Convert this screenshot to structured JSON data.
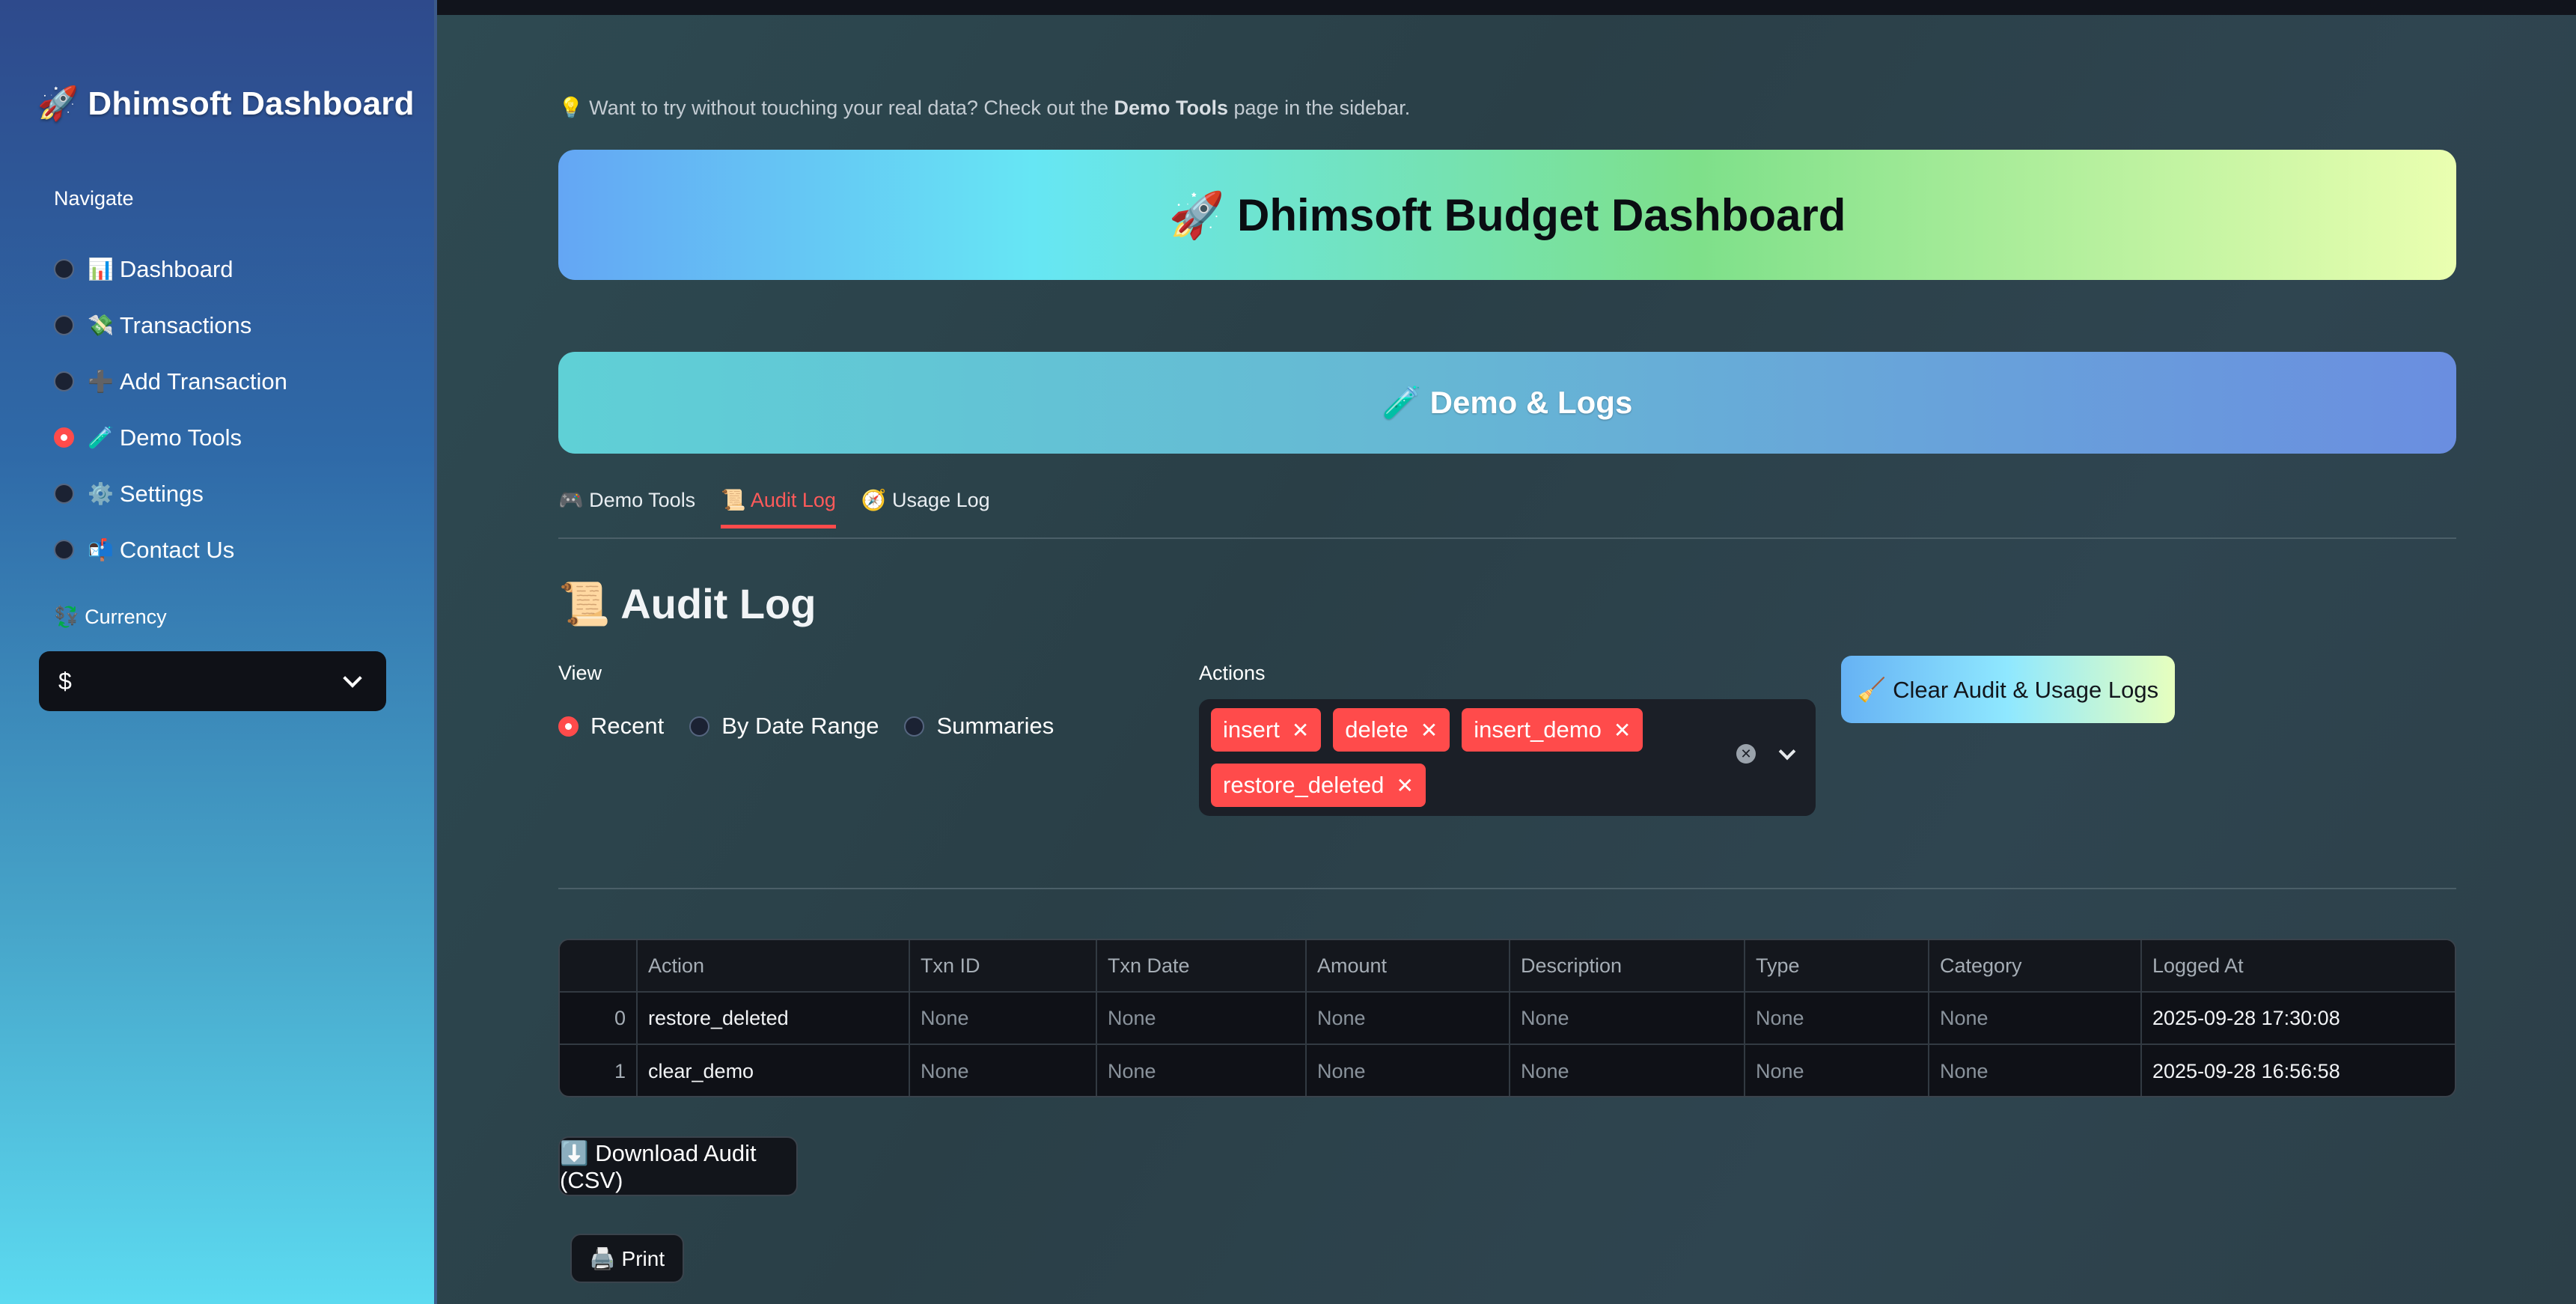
{
  "sidebar": {
    "brand": "🚀 Dhimsoft Dashboard",
    "navigate_label": "Navigate",
    "items": [
      {
        "icon": "📊",
        "label": "Dashboard"
      },
      {
        "icon": "💸",
        "label": "Transactions"
      },
      {
        "icon": "➕",
        "label": "Add Transaction"
      },
      {
        "icon": "🧪",
        "label": "Demo Tools"
      },
      {
        "icon": "⚙️",
        "label": "Settings"
      },
      {
        "icon": "📬",
        "label": "Contact Us"
      }
    ],
    "selected_index": 3,
    "currency_label": "💱 Currency",
    "currency_value": "$"
  },
  "hint": {
    "prefix": "💡 Want to try without touching your real data? Check out the ",
    "bold": "Demo Tools",
    "suffix": " page in the sidebar."
  },
  "hero_title": "🚀 Dhimsoft Budget Dashboard",
  "section_banner": "🧪 Demo & Logs",
  "tabs": [
    {
      "label": "🎮 Demo Tools"
    },
    {
      "label": "📜 Audit Log"
    },
    {
      "label": "🧭 Usage Log"
    }
  ],
  "active_tab": 1,
  "page_title": "📜 Audit Log",
  "view": {
    "label": "View",
    "options": [
      "Recent",
      "By Date Range",
      "Summaries"
    ],
    "selected_index": 0
  },
  "actions": {
    "label": "Actions",
    "chips": [
      "insert",
      "delete",
      "insert_demo",
      "restore_deleted"
    ]
  },
  "clear_button": "🧹 Clear Audit & Usage Logs",
  "table": {
    "columns": [
      "",
      "Action",
      "Txn ID",
      "Txn Date",
      "Amount",
      "Description",
      "Type",
      "Category",
      "Logged At"
    ],
    "rows": [
      [
        "0",
        "restore_deleted",
        "None",
        "None",
        "None",
        "None",
        "None",
        "None",
        "2025-09-28 17:30:08"
      ],
      [
        "1",
        "clear_demo",
        "None",
        "None",
        "None",
        "None",
        "None",
        "None",
        "2025-09-28 16:56:58"
      ]
    ]
  },
  "download_button": "⬇️ Download Audit (CSV)",
  "print_button": "🖨️ Print",
  "colors": {
    "accent": "#ff4b4b",
    "sidebar_top": "#2e4a8c",
    "sidebar_bottom": "#5cdaf0"
  }
}
